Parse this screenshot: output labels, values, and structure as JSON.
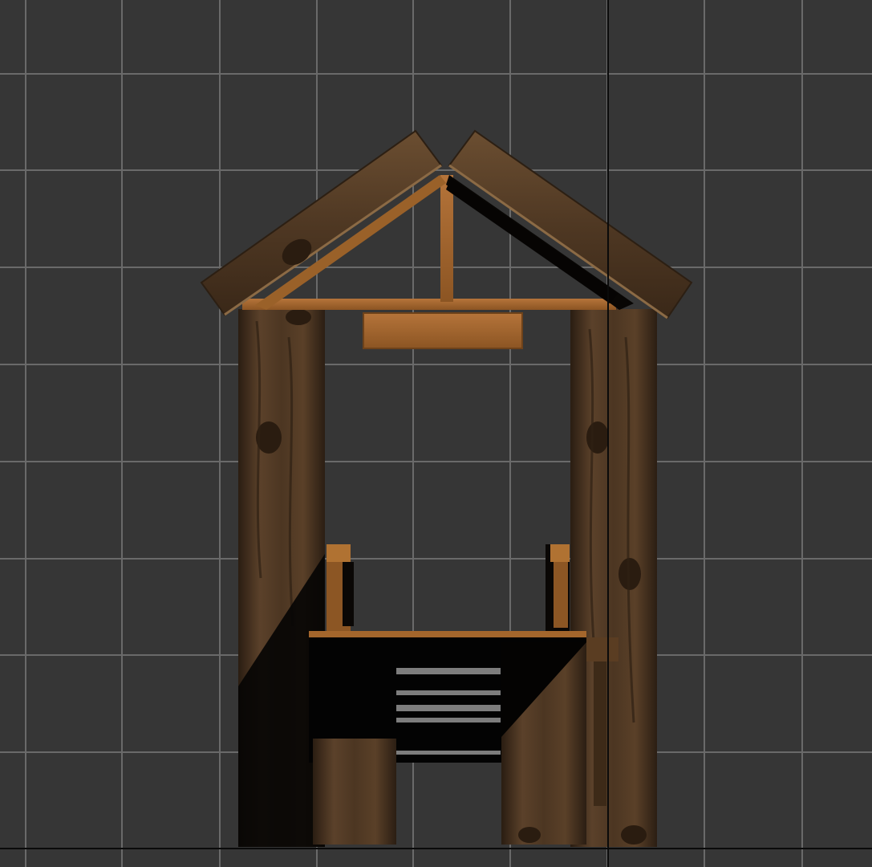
{
  "viewport": {
    "background": "#363636",
    "grid_color": "#6a6a6a",
    "axis_color": "#0a0a0a"
  },
  "scene": {
    "object": "wooden-well",
    "wood_dark": "#3e2c1c",
    "wood_mid": "#5a4129",
    "wood_light": "#a0652c",
    "shadow": "#050505"
  }
}
